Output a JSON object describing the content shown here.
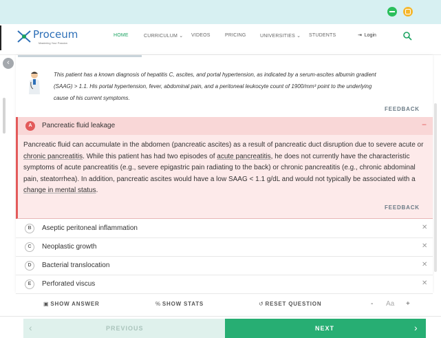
{
  "colors": {
    "accent_green": "#1aa260",
    "selected_red": "#e35a5a",
    "brand_blue": "#2d6fb7",
    "next_button": "#27ae73"
  },
  "window_controls": {
    "minimize_icon": "minimize-icon",
    "restore_icon": "restore-icon"
  },
  "header": {
    "logo_text": "Proceum",
    "logo_tagline": "Mastering Your Passion",
    "nav": [
      "HOME",
      "CURRICULUM",
      "VIDEOS",
      "PRICING",
      "UNIVERSITIES",
      "STUDENTS"
    ],
    "active_nav": "HOME",
    "login_label": "Login"
  },
  "explanation": {
    "text_1": "This patient has a known diagnosis of hepatitis C, ascites, and portal hypertension, as indicated by a serum-ascites albumin gradient",
    "text_2": "(SAAG) > 1.1. His portal hypertension, fever, abdominal pain, and a peritoneal leukocyte count of 1900/mm³ point to the underlying",
    "text_3": "cause of his current symptoms.",
    "feedback_label": "FEEDBACK"
  },
  "selected_option": {
    "letter": "A",
    "label": "Pancreatic fluid leakage",
    "body_p1": "Pancreatic fluid can accumulate in the abdomen (pancreatic ascites) as a result of pancreatic duct disruption due to severe acute or ",
    "body_link1": "chronic pancreatitis",
    "body_p2": ". While this patient has had two episodes of ",
    "body_link2": "acute pancreatitis",
    "body_p3": ", he does not currently have the characteristic symptoms of acute pancreatitis (e.g., severe epigastric pain radiating to the back) or chronic pancreatitis (e.g., chronic abdominal pain, steatorrhea). In addition, pancreatic ascites would have a low SAAG < 1.1 g/dL and would not typically be associated with a ",
    "body_link3": "change in mental status",
    "body_p4": ".",
    "feedback_label": "FEEDBACK"
  },
  "options": [
    {
      "letter": "B",
      "label": "Aseptic peritoneal inflammation"
    },
    {
      "letter": "C",
      "label": "Neoplastic growth"
    },
    {
      "letter": "D",
      "label": "Bacterial translocation"
    },
    {
      "letter": "E",
      "label": "Perforated viscus"
    }
  ],
  "toolbar": {
    "show_answer": "SHOW ANSWER",
    "show_stats": "SHOW STATS",
    "reset_question": "RESET QUESTION",
    "font_decrease": "-",
    "font_label": "Aa",
    "font_increase": "+"
  },
  "footer": {
    "previous_label": "PREVIOUS",
    "next_label": "NEXT"
  }
}
